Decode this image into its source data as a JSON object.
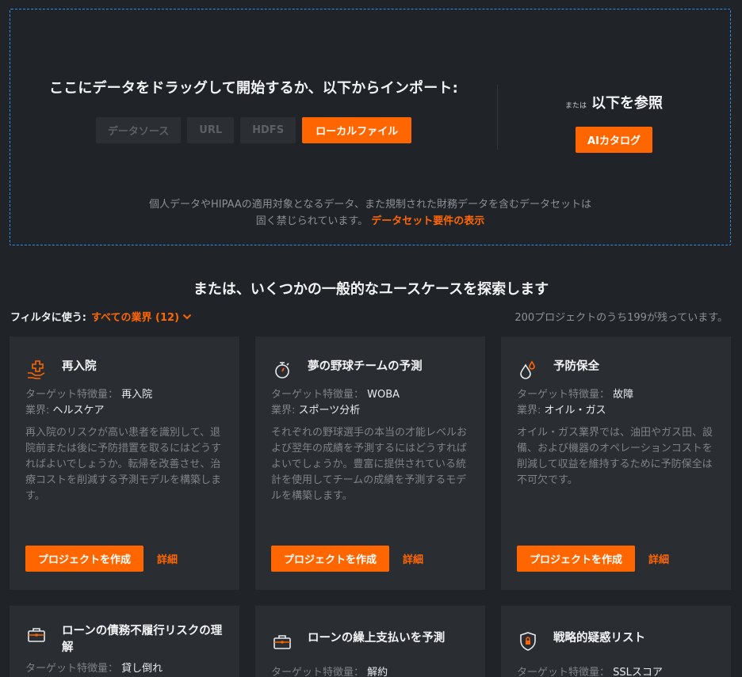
{
  "dropzone": {
    "prompt": "ここにデータをドラッグして開始するか、以下からインポート:",
    "sources": [
      "データソース",
      "URL",
      "HDFS",
      "ローカルファイル"
    ],
    "or_label": "または",
    "browse_label": "以下を参照",
    "catalog_button": "AIカタログ",
    "notice_line1": "個人データやHIPAAの適用対象となるデータ、また規制された財務データを含むデータセットは",
    "notice_line2": "固く禁じられています。",
    "notice_link": "データセット要件の表示"
  },
  "usecases": {
    "title": "または、いくつかの一般的なユースケースを探索します",
    "filter_label": "フィルタに使う:",
    "filter_value": "すべての業界 (12)",
    "count_text": "200プロジェクトのうち199が残っています。",
    "target_key": "ターゲット特徴量：",
    "industry_key": "業界:",
    "create_button": "プロジェクトを作成",
    "detail_link": "詳細",
    "cards": [
      {
        "icon": "medical-hand-icon",
        "title": "再入院",
        "target": "再入院",
        "industry": "ヘルスケア",
        "description": "再入院のリスクが高い患者を識別して、退院前または後に予防措置を取るにはどうすればよいでしょうか。転帰を改善させ、治療コストを削減する予測モデルを構築します。"
      },
      {
        "icon": "stopwatch-icon",
        "title": "夢の野球チームの予測",
        "target": "WOBA",
        "industry": "スポーツ分析",
        "description": "それぞれの野球選手の本当の才能レベルおよび翌年の成績を予測するにはどうすればよいでしょうか。豊富に提供されている統計を使用してチームの成績を予測するモデルを構築します。"
      },
      {
        "icon": "oil-drops-icon",
        "title": "予防保全",
        "target": "故障",
        "industry": "オイル・ガス",
        "description": "オイル・ガス業界では、油田やガス田、設備、および機器のオペレーションコストを削減して収益を維持するために予防保全は不可欠です。"
      },
      {
        "icon": "briefcase-icon",
        "title": "ローンの債務不履行リスクの理解",
        "target": "貸し倒れ",
        "industry": "",
        "description": ""
      },
      {
        "icon": "briefcase-icon",
        "title": "ローンの繰上支払いを予測",
        "target": "解約",
        "industry": "",
        "description": ""
      },
      {
        "icon": "shield-lock-icon",
        "title": "戦略的疑惑リスト",
        "target": "SSLスコア",
        "industry": "",
        "description": ""
      }
    ]
  },
  "colors": {
    "accent": "#ff6600",
    "background": "#202428",
    "card": "#2a2e33",
    "dashed_border": "#2f8fe0"
  }
}
